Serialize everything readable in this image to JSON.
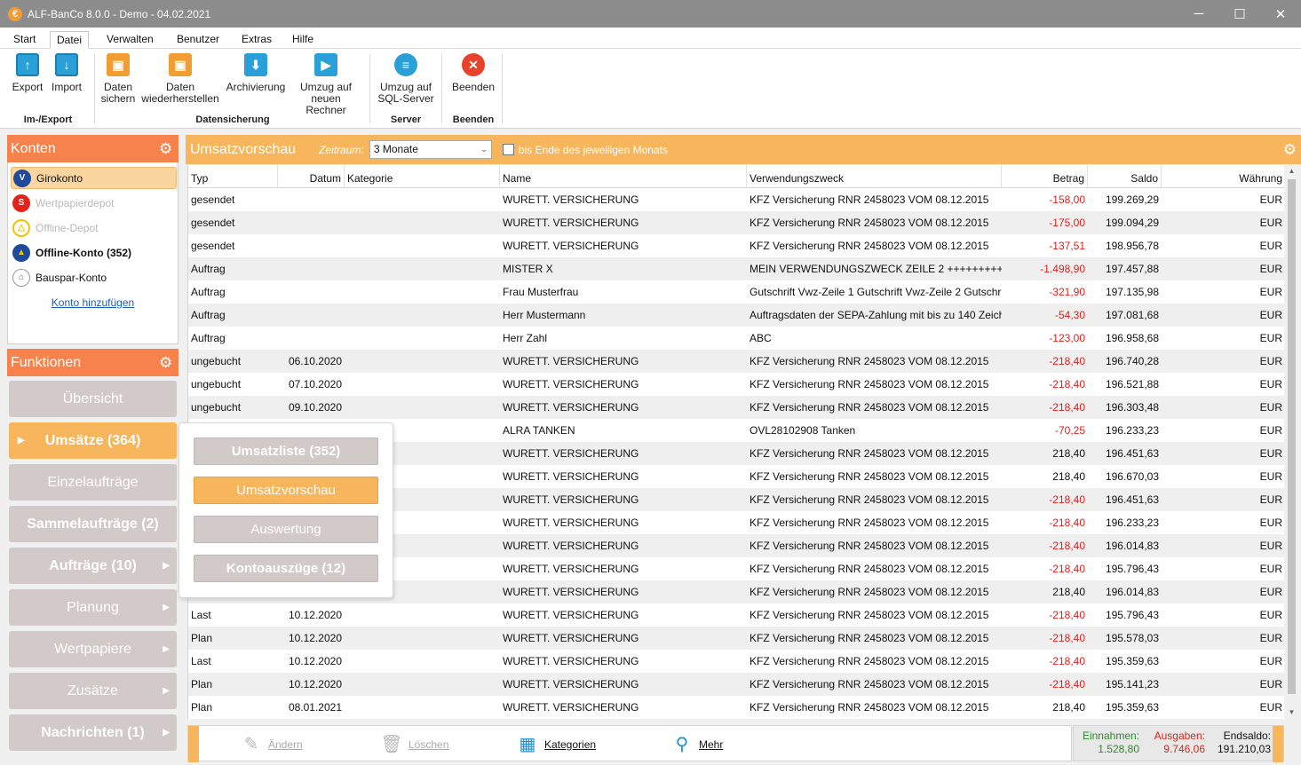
{
  "window": {
    "title": "ALF-BanCo 8.0.0 - Demo  -  04.02.2021",
    "controls": {
      "minimize": "─",
      "maximize": "☐",
      "close": "✕"
    }
  },
  "menu": {
    "tabs": [
      "Start",
      "Datei",
      "Verwalten",
      "Benutzer",
      "Extras",
      "Hilfe"
    ],
    "active": "Datei"
  },
  "ribbon": {
    "export": "Export",
    "import": "Import",
    "daten_sichern": [
      "Daten",
      "sichern"
    ],
    "daten_wiederherstellen": [
      "Daten",
      "wiederherstellen"
    ],
    "archivierung": "Archivierung",
    "umzug_rechner": [
      "Umzug auf",
      "neuen Rechner"
    ],
    "umzug_sql": [
      "Umzug auf",
      "SQL-Server"
    ],
    "beenden": "Beenden",
    "groups": {
      "im_export": "Im-/Export",
      "datensicherung": "Datensicherung",
      "server": "Server",
      "beenden": "Beenden"
    }
  },
  "konten": {
    "header": "Konten",
    "items": [
      {
        "label": "Girokonto",
        "icon": "volksbank-icon",
        "color": "#1e4a9c",
        "state": "selected"
      },
      {
        "label": "Wertpapierdepot",
        "icon": "sparkasse-icon",
        "color": "#e2231a",
        "state": "disabled"
      },
      {
        "label": "Offline-Depot",
        "icon": "depot-icon",
        "color": "#f2c200",
        "state": "disabled"
      },
      {
        "label": "Offline-Konto (352)",
        "icon": "offline-konto-icon",
        "color": "#1e4a9c",
        "state": "bold"
      },
      {
        "label": "Bauspar-Konto",
        "icon": "bank-icon",
        "color": "#777777",
        "state": "normal"
      }
    ],
    "add": "Konto hinzufügen"
  },
  "funktionen": {
    "header": "Funktionen",
    "buttons": [
      {
        "label": "Übersicht",
        "bold": false,
        "arrow": false
      },
      {
        "label": "Umsätze (364)",
        "bold": true,
        "arrow": false,
        "active": true
      },
      {
        "label": "Einzelaufträge",
        "bold": false,
        "arrow": false
      },
      {
        "label": "Sammelaufträge (2)",
        "bold": true,
        "arrow": false
      },
      {
        "label": "Aufträge (10)",
        "bold": true,
        "arrow": true
      },
      {
        "label": "Planung",
        "bold": false,
        "arrow": true
      },
      {
        "label": "Wertpapiere",
        "bold": false,
        "arrow": true
      },
      {
        "label": "Zusätze",
        "bold": false,
        "arrow": true
      },
      {
        "label": "Nachrichten (1)",
        "bold": true,
        "arrow": true
      }
    ]
  },
  "submenu": [
    {
      "label": "Umsatzliste (352)",
      "bold": true
    },
    {
      "label": "Umsatzvorschau",
      "bold": false,
      "active": true
    },
    {
      "label": "Auswertung",
      "bold": false
    },
    {
      "label": "Kontoauszüge (12)",
      "bold": true
    }
  ],
  "main": {
    "title": "Umsatzvorschau",
    "zeitraum_label": "Zeitraum:",
    "zeitraum_value": "3 Monate",
    "checkbox_label": "bis Ende des jeweiligen Monats",
    "checkbox_checked": false
  },
  "table": {
    "columns": [
      "Typ",
      "Datum",
      "Kategorie",
      "Name",
      "Verwendungszweck",
      "Betrag",
      "Saldo",
      "Währung"
    ],
    "rows": [
      [
        "gesendet",
        "",
        "",
        "WURETT. VERSICHERUNG",
        "KFZ Versicherung  RNR 2458023 VOM 08.12.2015",
        "-158,00",
        "199.269,29",
        "EUR"
      ],
      [
        "gesendet",
        "",
        "",
        "WURETT. VERSICHERUNG",
        "KFZ Versicherung  RNR 2458023 VOM 08.12.2015",
        "-175,00",
        "199.094,29",
        "EUR"
      ],
      [
        "gesendet",
        "",
        "",
        "WURETT. VERSICHERUNG",
        "KFZ Versicherung  RNR 2458023 VOM 08.12.2015",
        "-137,51",
        "198.956,78",
        "EUR"
      ],
      [
        "Auftrag",
        "",
        "",
        "MISTER X",
        "MEIN VERWENDUNGSZWECK ZEILE 2 +++++++++",
        "-1.498,90",
        "197.457,88",
        "EUR"
      ],
      [
        "Auftrag",
        "",
        "",
        "Frau Musterfrau",
        "Gutschrift Vwz-Zeile 1 Gutschrift Vwz-Zeile 2 Gutschr",
        "-321,90",
        "197.135,98",
        "EUR"
      ],
      [
        "Auftrag",
        "",
        "",
        "Herr Mustermann",
        "Auftragsdaten der SEPA-Zahlung mit bis zu 140 Zeich",
        "-54,30",
        "197.081,68",
        "EUR"
      ],
      [
        "Auftrag",
        "",
        "",
        "Herr Zahl",
        "ABC",
        "-123,00",
        "196.958,68",
        "EUR"
      ],
      [
        "ungebucht",
        "06.10.2020",
        "",
        "WURETT. VERSICHERUNG",
        "KFZ Versicherung  RNR 2458023 VOM 08.12.2015",
        "-218,40",
        "196.740,28",
        "EUR"
      ],
      [
        "ungebucht",
        "07.10.2020",
        "",
        "WURETT. VERSICHERUNG",
        "KFZ Versicherung  RNR 2458023 VOM 08.12.2015",
        "-218,40",
        "196.521,88",
        "EUR"
      ],
      [
        "ungebucht",
        "09.10.2020",
        "",
        "WURETT. VERSICHERUNG",
        "KFZ Versicherung  RNR 2458023 VOM 08.12.2015",
        "-218,40",
        "196.303,48",
        "EUR"
      ],
      [
        "",
        "",
        "",
        "ALRA TANKEN",
        "OVL28102908 Tanken",
        "-70,25",
        "196.233,23",
        "EUR"
      ],
      [
        "",
        "",
        "",
        "WURETT. VERSICHERUNG",
        "KFZ Versicherung  RNR 2458023 VOM 08.12.2015",
        "218,40",
        "196.451,63",
        "EUR"
      ],
      [
        "",
        "",
        "",
        "WURETT. VERSICHERUNG",
        "KFZ Versicherung  RNR 2458023 VOM 08.12.2015",
        "218,40",
        "196.670,03",
        "EUR"
      ],
      [
        "",
        "",
        "",
        "WURETT. VERSICHERUNG",
        "KFZ Versicherung  RNR 2458023 VOM 08.12.2015",
        "-218,40",
        "196.451,63",
        "EUR"
      ],
      [
        "",
        "",
        "",
        "WURETT. VERSICHERUNG",
        "KFZ Versicherung  RNR 2458023 VOM 08.12.2015",
        "-218,40",
        "196.233,23",
        "EUR"
      ],
      [
        "",
        "",
        "",
        "WURETT. VERSICHERUNG",
        "KFZ Versicherung  RNR 2458023 VOM 08.12.2015",
        "-218,40",
        "196.014,83",
        "EUR"
      ],
      [
        "",
        "",
        "",
        "WURETT. VERSICHERUNG",
        "KFZ Versicherung  RNR 2458023 VOM 08.12.2015",
        "-218,40",
        "195.796,43",
        "EUR"
      ],
      [
        "",
        "",
        "",
        "WURETT. VERSICHERUNG",
        "KFZ Versicherung  RNR 2458023 VOM 08.12.2015",
        "218,40",
        "196.014,83",
        "EUR"
      ],
      [
        "Last",
        "10.12.2020",
        "",
        "WURETT. VERSICHERUNG",
        "KFZ Versicherung  RNR 2458023 VOM 08.12.2015",
        "-218,40",
        "195.796,43",
        "EUR"
      ],
      [
        "Plan",
        "10.12.2020",
        "",
        "WURETT. VERSICHERUNG",
        "KFZ Versicherung  RNR 2458023 VOM 08.12.2015",
        "-218,40",
        "195.578,03",
        "EUR"
      ],
      [
        "Last",
        "10.12.2020",
        "",
        "WURETT. VERSICHERUNG",
        "KFZ Versicherung  RNR 2458023 VOM 08.12.2015",
        "-218,40",
        "195.359,63",
        "EUR"
      ],
      [
        "Plan",
        "10.12.2020",
        "",
        "WURETT. VERSICHERUNG",
        "KFZ Versicherung  RNR 2458023 VOM 08.12.2015",
        "-218,40",
        "195.141,23",
        "EUR"
      ],
      [
        "Plan",
        "08.01.2021",
        "",
        "WURETT. VERSICHERUNG",
        "KFZ Versicherung  RNR 2458023 VOM 08.12.2015",
        "218,40",
        "195.359,63",
        "EUR"
      ]
    ]
  },
  "toolbar": {
    "aendern": "Ändern",
    "loeschen": "Löschen",
    "kategorien": "Kategorien",
    "mehr": "Mehr"
  },
  "saldo": {
    "einnahmen_label": "Einnahmen:",
    "einnahmen_value": "1.528,80",
    "ausgaben_label": "Ausgaben:",
    "ausgaben_value": "9.746,06",
    "endsaldo_label": "Endsaldo:",
    "endsaldo_value": "191.210,03"
  },
  "colors": {
    "accent_orange": "#f7824b",
    "accent_light": "#f7b55c",
    "negative": "#e0201c",
    "income": "#2d8a2d"
  }
}
